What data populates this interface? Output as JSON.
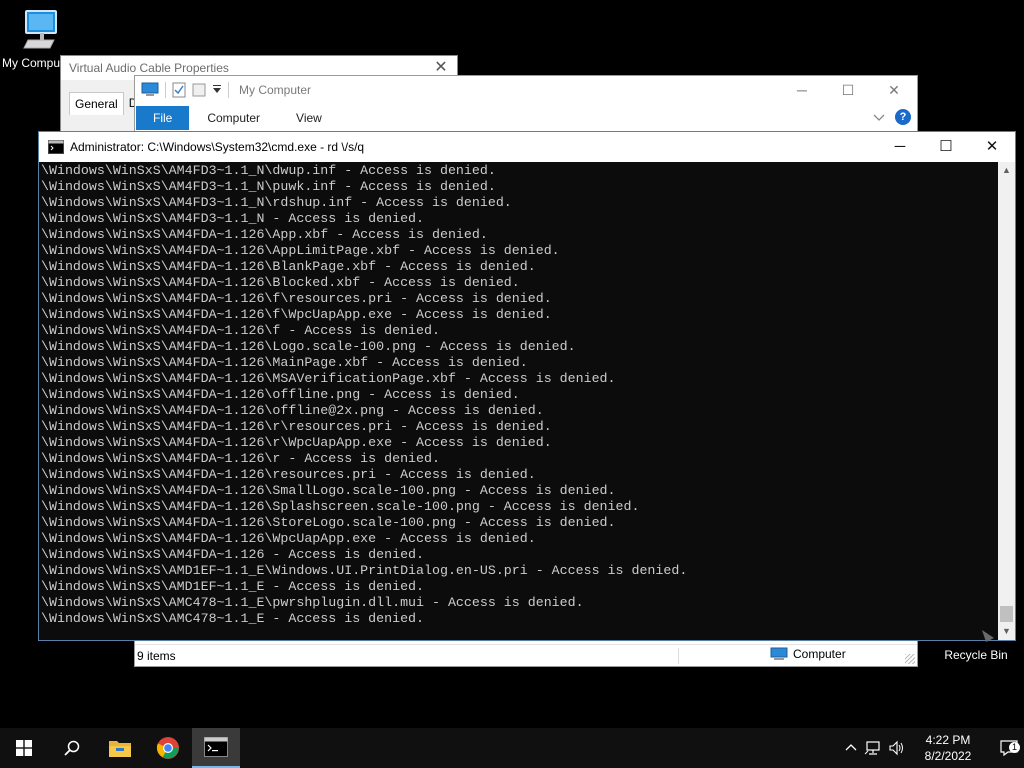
{
  "desktop": {
    "icons": [
      {
        "label": "My Computer"
      },
      {
        "label": "Recycle Bin"
      }
    ]
  },
  "vac_window": {
    "title": "Virtual Audio Cable Properties",
    "close": "✕",
    "tabs": [
      "General",
      "Dr"
    ]
  },
  "explorer": {
    "title": "My Computer",
    "tabs": [
      "File",
      "Computer",
      "View"
    ],
    "controls": {
      "minimize": "─",
      "maximize": "☐",
      "close": "✕"
    },
    "help": "?",
    "status": {
      "items": "9 items",
      "location": "Computer"
    }
  },
  "cmd": {
    "title": "Administrator: C:\\Windows\\System32\\cmd.exe - rd \\/s/q",
    "controls": {
      "minimize": "─",
      "maximize": "☐",
      "close": "✕"
    },
    "lines": [
      "\\Windows\\WinSxS\\AM4FD3~1.1_N\\dwup.inf - Access is denied.",
      "\\Windows\\WinSxS\\AM4FD3~1.1_N\\puwk.inf - Access is denied.",
      "\\Windows\\WinSxS\\AM4FD3~1.1_N\\rdshup.inf - Access is denied.",
      "\\Windows\\WinSxS\\AM4FD3~1.1_N - Access is denied.",
      "\\Windows\\WinSxS\\AM4FDA~1.126\\App.xbf - Access is denied.",
      "\\Windows\\WinSxS\\AM4FDA~1.126\\AppLimitPage.xbf - Access is denied.",
      "\\Windows\\WinSxS\\AM4FDA~1.126\\BlankPage.xbf - Access is denied.",
      "\\Windows\\WinSxS\\AM4FDA~1.126\\Blocked.xbf - Access is denied.",
      "\\Windows\\WinSxS\\AM4FDA~1.126\\f\\resources.pri - Access is denied.",
      "\\Windows\\WinSxS\\AM4FDA~1.126\\f\\WpcUapApp.exe - Access is denied.",
      "\\Windows\\WinSxS\\AM4FDA~1.126\\f - Access is denied.",
      "\\Windows\\WinSxS\\AM4FDA~1.126\\Logo.scale-100.png - Access is denied.",
      "\\Windows\\WinSxS\\AM4FDA~1.126\\MainPage.xbf - Access is denied.",
      "\\Windows\\WinSxS\\AM4FDA~1.126\\MSAVerificationPage.xbf - Access is denied.",
      "\\Windows\\WinSxS\\AM4FDA~1.126\\offline.png - Access is denied.",
      "\\Windows\\WinSxS\\AM4FDA~1.126\\offline@2x.png - Access is denied.",
      "\\Windows\\WinSxS\\AM4FDA~1.126\\r\\resources.pri - Access is denied.",
      "\\Windows\\WinSxS\\AM4FDA~1.126\\r\\WpcUapApp.exe - Access is denied.",
      "\\Windows\\WinSxS\\AM4FDA~1.126\\r - Access is denied.",
      "\\Windows\\WinSxS\\AM4FDA~1.126\\resources.pri - Access is denied.",
      "\\Windows\\WinSxS\\AM4FDA~1.126\\SmallLogo.scale-100.png - Access is denied.",
      "\\Windows\\WinSxS\\AM4FDA~1.126\\Splashscreen.scale-100.png - Access is denied.",
      "\\Windows\\WinSxS\\AM4FDA~1.126\\StoreLogo.scale-100.png - Access is denied.",
      "\\Windows\\WinSxS\\AM4FDA~1.126\\WpcUapApp.exe - Access is denied.",
      "\\Windows\\WinSxS\\AM4FDA~1.126 - Access is denied.",
      "\\Windows\\WinSxS\\AMD1EF~1.1_E\\Windows.UI.PrintDialog.en-US.pri - Access is denied.",
      "\\Windows\\WinSxS\\AMD1EF~1.1_E - Access is denied.",
      "\\Windows\\WinSxS\\AMC478~1.1_E\\pwrshplugin.dll.mui - Access is denied.",
      "\\Windows\\WinSxS\\AMC478~1.1_E - Access is denied."
    ]
  },
  "taskbar": {
    "buttons": [
      "start-icon",
      "search-icon",
      "file-explorer-icon",
      "chrome-icon",
      "cmd-icon"
    ],
    "clock": {
      "time": "4:22 PM",
      "date": "8/2/2022"
    },
    "notifications": "1"
  }
}
